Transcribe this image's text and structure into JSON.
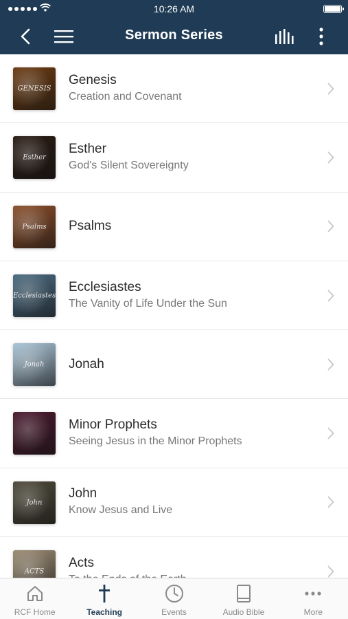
{
  "status": {
    "time": "10:26 AM"
  },
  "nav": {
    "title": "Sermon Series"
  },
  "series": [
    {
      "title": "Genesis",
      "subtitle": "Creation and Covenant",
      "thumb_text": "GENESIS",
      "thumb_bg": "#6b3b12"
    },
    {
      "title": "Esther",
      "subtitle": "God's Silent Sovereignty",
      "thumb_text": "Esther",
      "thumb_bg": "#2a1c14"
    },
    {
      "title": "Psalms",
      "subtitle": "",
      "thumb_text": "Psalms",
      "thumb_bg": "#8a4e2a"
    },
    {
      "title": "Ecclesiastes",
      "subtitle": "The Vanity of Life Under the Sun",
      "thumb_text": "Ecclesiastes",
      "thumb_bg": "#4a6a80"
    },
    {
      "title": "Jonah",
      "subtitle": "",
      "thumb_text": "Jonah",
      "thumb_bg": "#a9c4d6"
    },
    {
      "title": "Minor Prophets",
      "subtitle": "Seeing Jesus in the Minor Prophets",
      "thumb_text": "",
      "thumb_bg": "#4a1a2e"
    },
    {
      "title": "John",
      "subtitle": "Know Jesus and Live",
      "thumb_text": "John",
      "thumb_bg": "#4e4a3a"
    },
    {
      "title": "Acts",
      "subtitle": "To the Ends of the Earth",
      "thumb_text": "ACTS",
      "thumb_bg": "#9a8a72"
    }
  ],
  "tabs": [
    {
      "label": "RCF Home",
      "icon": "home-icon",
      "active": false
    },
    {
      "label": "Teaching",
      "icon": "cross-icon",
      "active": true
    },
    {
      "label": "Events",
      "icon": "clock-icon",
      "active": false
    },
    {
      "label": "Audio Bible",
      "icon": "book-icon",
      "active": false
    },
    {
      "label": "More",
      "icon": "more-dots-icon",
      "active": false
    }
  ],
  "colors": {
    "header": "#1f3b55",
    "accent": "#1f3b55",
    "tab_inactive": "#8a8a8a"
  }
}
